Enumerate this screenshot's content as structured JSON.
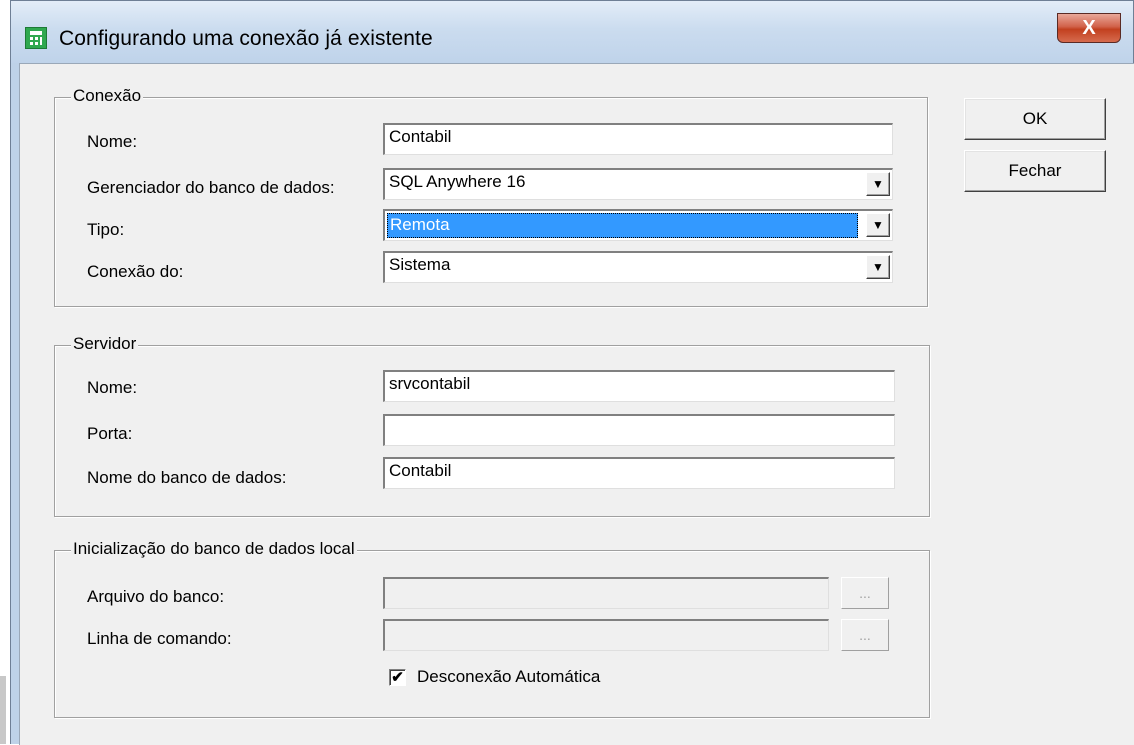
{
  "window": {
    "title": "Configurando uma conexão já existente",
    "close_label": "X",
    "icon": "calculator-icon"
  },
  "buttons": {
    "ok_label": "OK",
    "fechar_label": "Fechar"
  },
  "conexao": {
    "title": "Conexão",
    "nome_label": "Nome:",
    "nome_value": "Contabil",
    "gerenciador_label": "Gerenciador do banco de dados:",
    "gerenciador_value": "SQL Anywhere 16",
    "tipo_label": "Tipo:",
    "tipo_value": "Remota",
    "conexao_do_label": "Conexão do:",
    "conexao_do_value": "Sistema"
  },
  "servidor": {
    "title": "Servidor",
    "nome_label": "Nome:",
    "nome_value": "srvcontabil",
    "porta_label": "Porta:",
    "porta_value": "",
    "banco_label": "Nome do banco de dados:",
    "banco_value": "Contabil"
  },
  "inicializacao": {
    "title": "Inicialização do banco de dados local",
    "arquivo_label": "Arquivo do banco:",
    "arquivo_value": "",
    "linha_label": "Linha de comando:",
    "linha_value": "",
    "browse_label": "...",
    "desconexao_label": "Desconexão Automática",
    "desconexao_checked": true,
    "check_glyph": "✔"
  },
  "dropdown_glyph": "▼",
  "colors": {
    "selection": "#3399ff",
    "close_button": "#c2401f",
    "dialog_bg": "#f0f0f0"
  }
}
